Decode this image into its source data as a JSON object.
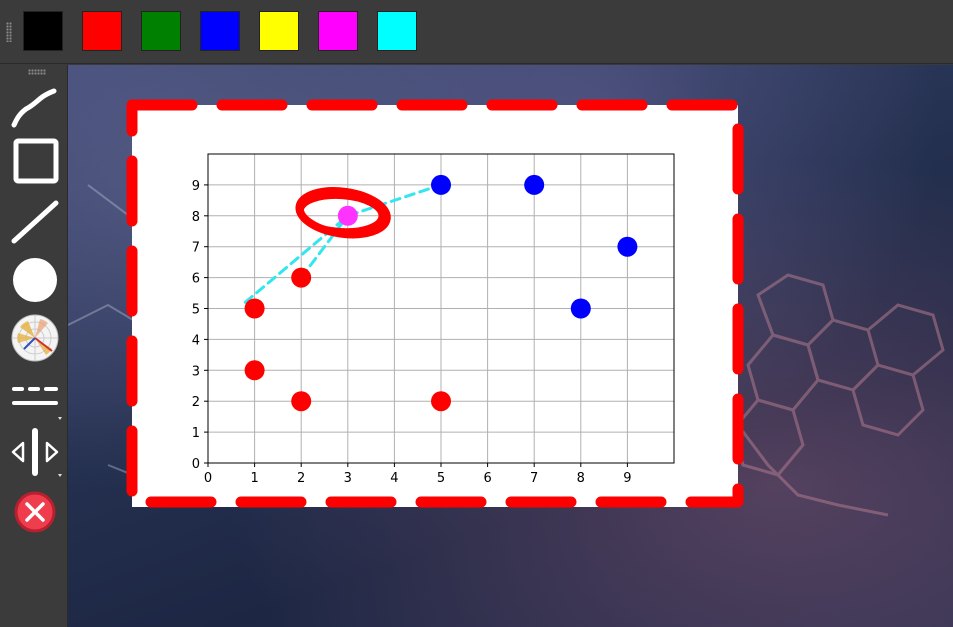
{
  "colors": {
    "palette": [
      "#000000",
      "#ff0000",
      "#008000",
      "#0000ff",
      "#ffff00",
      "#ff00ff",
      "#00ffff"
    ],
    "palette_names": [
      "black-swatch",
      "red-swatch",
      "green-swatch",
      "blue-swatch",
      "yellow-swatch",
      "magenta-swatch",
      "cyan-swatch"
    ],
    "annotation_red": "#ff0000",
    "annotation_cyan": "#33e6ee",
    "annotation_magenta": "#ff33ff",
    "annotation_blue": "#0000ff"
  },
  "tools": [
    {
      "name": "freehand-tool",
      "icon": "curve-icon"
    },
    {
      "name": "rectangle-tool",
      "icon": "square-icon"
    },
    {
      "name": "line-tool",
      "icon": "line-icon"
    },
    {
      "name": "circle-tool",
      "icon": "circle-icon"
    },
    {
      "name": "image-stamp-tool",
      "icon": "polar-chart-icon"
    },
    {
      "name": "line-style-tool",
      "icon": "dashed-line-icon"
    },
    {
      "name": "width-tool",
      "icon": "resize-horizontal-icon"
    },
    {
      "name": "close-tool",
      "icon": "close-icon"
    }
  ],
  "chart_data": {
    "type": "scatter",
    "x_ticks": [
      "0",
      "1",
      "2",
      "3",
      "4",
      "5",
      "6",
      "7",
      "8",
      "9"
    ],
    "y_ticks": [
      "0",
      "1",
      "2",
      "3",
      "4",
      "5",
      "6",
      "7",
      "8",
      "9"
    ],
    "xlim": [
      0,
      10
    ],
    "ylim": [
      0,
      10
    ],
    "grid": true,
    "series": [
      {
        "color": "#ff0000",
        "points": [
          [
            1,
            5
          ],
          [
            1,
            3
          ],
          [
            2,
            2
          ],
          [
            2,
            6
          ],
          [
            5,
            2
          ]
        ]
      },
      {
        "color": "#0000ff",
        "points": [
          [
            5,
            9
          ],
          [
            7,
            9
          ],
          [
            8,
            5
          ],
          [
            9,
            7
          ]
        ]
      },
      {
        "color": "#ff33ff",
        "points": [
          [
            3,
            8
          ]
        ]
      }
    ],
    "annotations": [
      {
        "type": "dashed-line",
        "color": "#33e6ee",
        "points": [
          [
            0.8,
            5.2
          ],
          [
            3,
            8
          ],
          [
            5,
            9
          ]
        ]
      },
      {
        "type": "dashed-line",
        "color": "#33e6ee",
        "points": [
          [
            2,
            6
          ],
          [
            3,
            8
          ]
        ]
      },
      {
        "type": "ellipse",
        "color": "#ff0000",
        "center": [
          2.9,
          8.1
        ]
      }
    ]
  }
}
